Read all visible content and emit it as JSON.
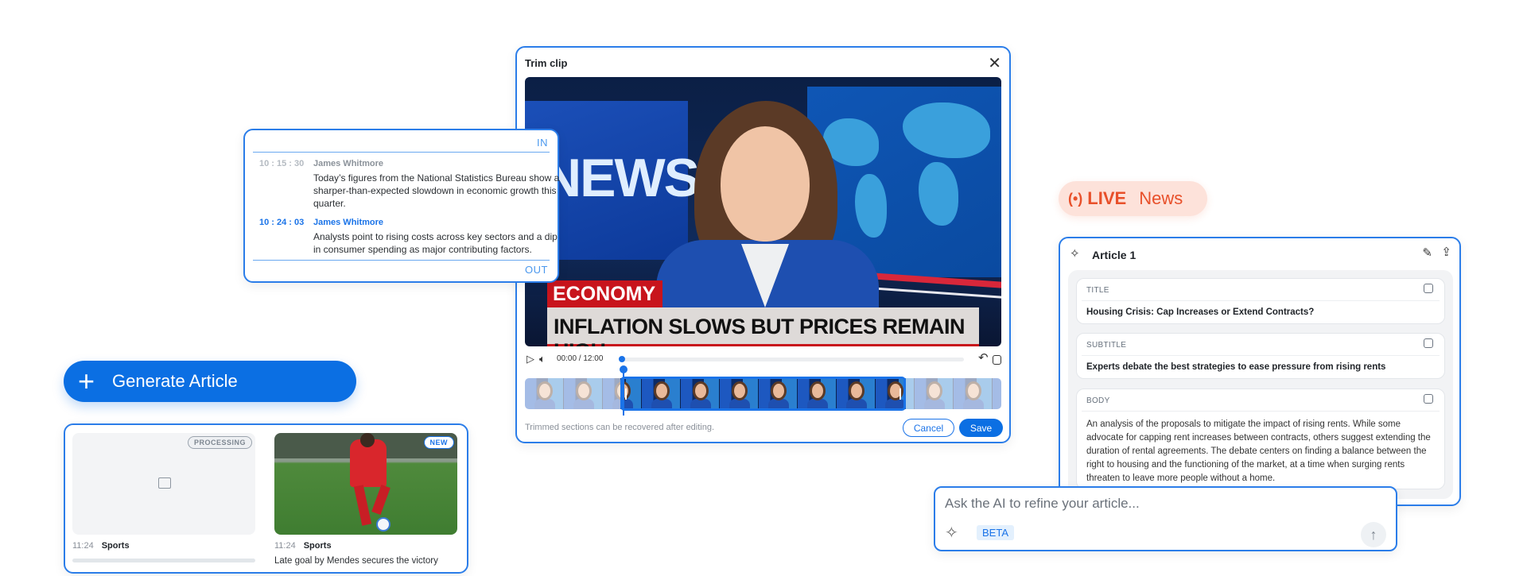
{
  "colors": {
    "accent": "#0b6fe3",
    "live": "#e8502a",
    "live_bg": "#fde2da",
    "panel_border": "#2b7de9"
  },
  "transcript": {
    "in_label": "IN",
    "out_label": "OUT",
    "entries": [
      {
        "time": "10 : 15 : 30",
        "speaker": "James Whitmore",
        "text": "Today’s figures from the National Statistics Bureau show a sharper-than-expected slowdown in economic growth this quarter.",
        "active": false
      },
      {
        "time": "10 : 24 : 03",
        "speaker": "James Whitmore",
        "text": "Analysts point to rising costs across key sectors and a dip in consumer spending as major contributing factors.",
        "active": true
      }
    ]
  },
  "trim_modal": {
    "title": "Trim clip",
    "close_icon": "close-icon",
    "video": {
      "backdrop_text": "NEWS",
      "category": "ECONOMY",
      "headline": "INFLATION SLOWS BUT PRICES REMAIN HIGH"
    },
    "time_display": "00:00 / 12:00",
    "playback_progress": 0,
    "selection": {
      "start_fraction": 0.2,
      "end_fraction": 0.8
    },
    "note": "Trimmed sections can be recovered after editing.",
    "cancel_label": "Cancel",
    "save_label": "Save"
  },
  "generate": {
    "label": "Generate Article",
    "icon": "plus-icon"
  },
  "cards": [
    {
      "status": "PROCESSING",
      "time": "11:24",
      "category": "Sports",
      "caption": ""
    },
    {
      "status": "NEW",
      "time": "11:24",
      "category": "Sports",
      "caption": "Late goal by Mendes secures the victory"
    }
  ],
  "live": {
    "label": "LIVE",
    "channel": "News",
    "icon": "broadcast-icon"
  },
  "article": {
    "title": "Article 1",
    "fields": [
      {
        "label": "TITLE",
        "value": "Housing Crisis: Cap Increases or Extend Contracts?"
      },
      {
        "label": "SUBTITLE",
        "value": "Experts debate the best strategies to ease pressure from rising rents"
      },
      {
        "label": "BODY",
        "value": "An analysis of the proposals to mitigate the impact of rising rents. While some advocate for capping rent increases between contracts, others suggest extending the duration of rental agreements. The debate centers on finding a balance between the right to housing and the functioning of the market, at a time when surging rents threaten to leave more people without a home."
      }
    ]
  },
  "ai_input": {
    "placeholder": "Ask the AI to refine your article...",
    "value": "",
    "badge": "BETA"
  }
}
